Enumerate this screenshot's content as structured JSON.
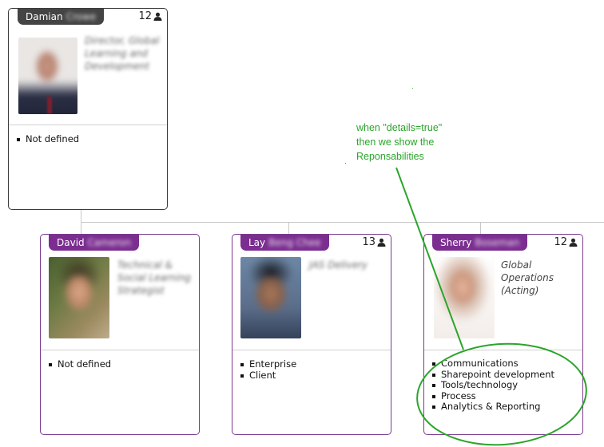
{
  "colors": {
    "accent_purple": "#7b2e90",
    "dark_tab": "#444444",
    "annotation_green": "#2aa52a",
    "connector": "#c8c8c8"
  },
  "people": [
    {
      "first_name": "Damian",
      "last_name": "Crowe",
      "count": "12",
      "title": "Director, Global Learning and Development",
      "responsibilities": [
        "Not defined"
      ]
    },
    {
      "first_name": "David",
      "last_name": "Cameron",
      "count": "",
      "title": "Technical & Social Learning Strategist",
      "responsibilities": [
        "Not defined"
      ]
    },
    {
      "first_name": "Lay",
      "last_name": "Beng Chee",
      "count": "13",
      "title": "JAS Delivery",
      "responsibilities": [
        "Enterprise",
        "Client"
      ]
    },
    {
      "first_name": "Sherry",
      "last_name": "Boseman",
      "count": "12",
      "title": "Global Operations (Acting)",
      "responsibilities": [
        "Communications",
        "Sharepoint development",
        "Tools/technology",
        "Process",
        "Analytics & Reporting"
      ]
    }
  ],
  "annotation": {
    "text": "when \"details=true\"\nthen we show the\nReponsabilities"
  },
  "icons": {
    "count_icon": "person-icon"
  }
}
